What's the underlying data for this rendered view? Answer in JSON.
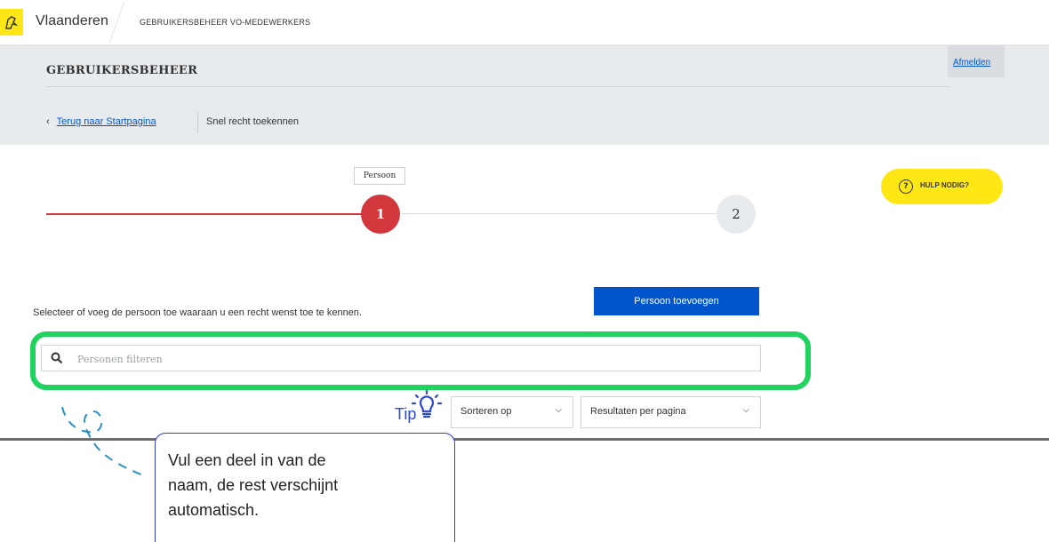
{
  "topbar": {
    "brand": "Vlaanderen",
    "app_title": "GEBRUIKERSBEHEER VO-MEDEWERKERS"
  },
  "header": {
    "title": "GEBRUIKERSBEHEER",
    "logout_label": "Afmelden",
    "back_link": "Terug naar Startpagina",
    "current_page": "Snel recht toekennen"
  },
  "stepper": {
    "step1_label": "Persoon",
    "step1_number": "1",
    "step2_number": "2",
    "active_color": "#d2373c"
  },
  "help": {
    "label": "HULP NODIG?",
    "icon": "?"
  },
  "main": {
    "instruction": "Selecteer of voeg de persoon toe waaraan u een recht wenst toe te kennen.",
    "add_button": "Persoon toevoegen",
    "search_placeholder": "Personen filteren",
    "sort_label": "Sorteren op",
    "per_page_label": "Resultaten per pagina"
  },
  "annotation": {
    "tip_label": "Tip",
    "callout_lines": [
      "Vul een deel in van de",
      "naam, de rest verschijnt",
      "automatisch."
    ],
    "highlight_color": "#1fd35e"
  },
  "colors": {
    "accent": "#0055cc",
    "yellow": "#ffe615",
    "header_bg": "#e8ebee"
  }
}
